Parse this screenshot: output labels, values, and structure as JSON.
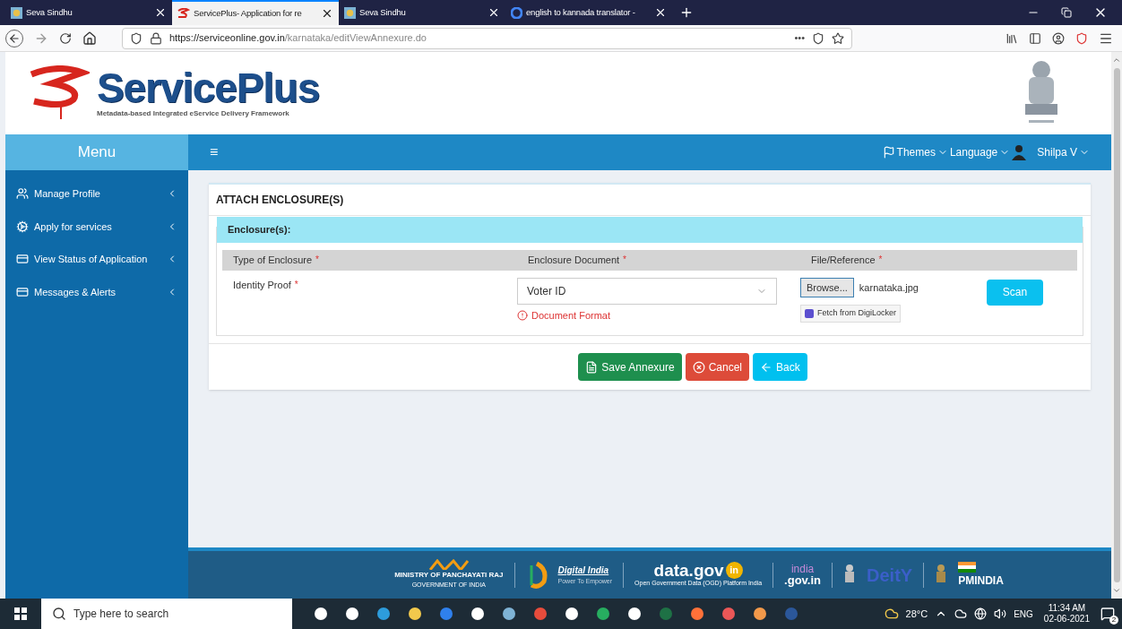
{
  "browser": {
    "tabs": [
      {
        "title": "Seva Sindhu",
        "kind": "site",
        "selected": false
      },
      {
        "title": "ServicePlus- Application for re",
        "kind": "sp",
        "selected": true
      },
      {
        "title": "Seva Sindhu",
        "kind": "site",
        "selected": false
      },
      {
        "title": "english to kannada translator -",
        "kind": "google",
        "selected": false
      }
    ],
    "url_host": "https://serviceonline.gov.in",
    "url_path": "/karnataka/editViewAnnexure.do",
    "url_dots": "•••"
  },
  "header": {
    "brand": "ServicePlus",
    "tagline": "Metadata-based Integrated eService Delivery Framework"
  },
  "navbar": {
    "menu_title": "Menu",
    "hamburger": "≡",
    "themes": "Themes",
    "language": "Language",
    "user": "Shilpa V"
  },
  "sidebar": {
    "items": [
      {
        "label": "Manage Profile",
        "kind": "users"
      },
      {
        "label": "Apply for services",
        "kind": "gears"
      },
      {
        "label": "View Status of Application",
        "kind": "card"
      },
      {
        "label": "Messages & Alerts",
        "kind": "card"
      }
    ]
  },
  "panel": {
    "title": "ATTACH ENCLOSURE(S)",
    "section": "Enclosure(s):",
    "columns": [
      {
        "label": "Type of Enclosure",
        "mark": "*"
      },
      {
        "label": "Enclosure Document",
        "mark": "*"
      },
      {
        "label": "File/Reference",
        "mark": "*"
      }
    ],
    "row": {
      "type": "Identity Proof",
      "mark": "*",
      "document": "Voter ID",
      "format_link": "Document Format",
      "browse": "Browse...",
      "file": "karnataka.jpg",
      "digilocker": "Fetch from DigiLocker",
      "scan": "Scan"
    },
    "buttons": [
      {
        "label": "Save Annexure",
        "kind": "save"
      },
      {
        "label": "Cancel",
        "kind": "cancel"
      },
      {
        "label": "Back",
        "kind": "back"
      }
    ]
  },
  "footer": {
    "panchayati": "MINISTRY OF PANCHAYATI RAJ",
    "panchayati_sub": "GOVERNMENT OF INDIA",
    "digital": "Digital India",
    "digital_sub": "Power To Empower",
    "datagov": "data.gov",
    "datagov_in": "in",
    "datagov_sub": "Open Government Data (OGD) Platform India",
    "india": "india",
    ".gov": ".gov.in",
    "deity": "DeitY",
    "pmindia": "PMINDIA"
  },
  "taskbar": {
    "search": "Type here to search",
    "temp": "28°C",
    "lang": "ENG",
    "time": "11:34 AM",
    "date": "02-06-2021",
    "notifications": "2"
  }
}
